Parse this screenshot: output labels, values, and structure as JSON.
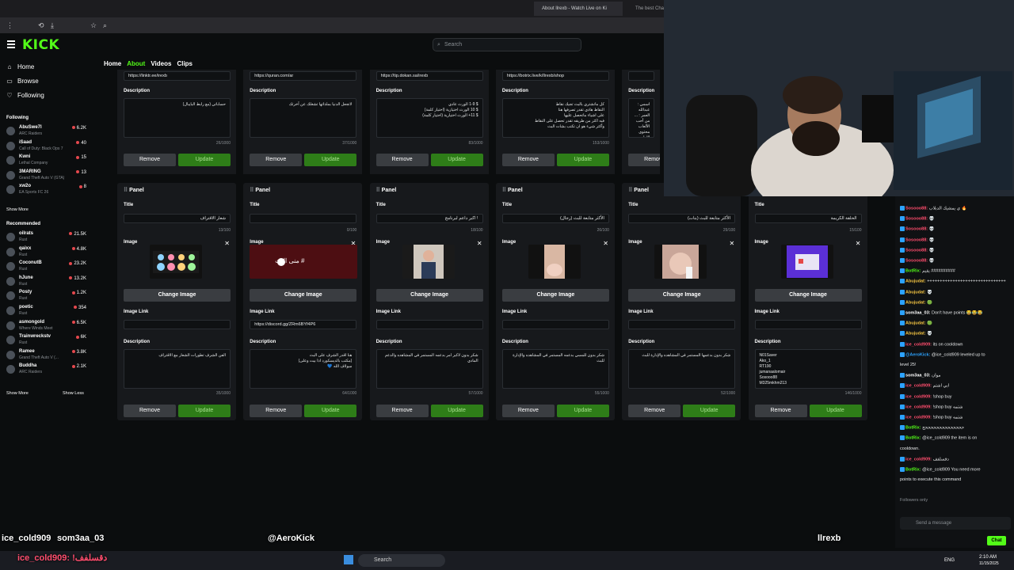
{
  "browser": {
    "tab_active": "About llrexb - Watch Live on Ki",
    "tab_other": "The best Cha"
  },
  "kick": {
    "logo": "KICK",
    "search_placeholder": "Search",
    "nav": {
      "home": "Home",
      "browse": "Browse",
      "following": "Following"
    },
    "tabs": {
      "home": "Home",
      "about": "About",
      "videos": "Videos",
      "clips": "Clips"
    }
  },
  "sidebar": {
    "following_header": "Following",
    "following": [
      {
        "name": "AbuSwe7l",
        "game": "ARC Raiders",
        "viewers": "6.2K"
      },
      {
        "name": "iSaad",
        "game": "Call of Duty: Black Ops 7",
        "viewers": "40"
      },
      {
        "name": "Kwni",
        "game": "Lethal Company",
        "viewers": "15"
      },
      {
        "name": "3MARING",
        "game": "Grand Theft Auto V (GTA)",
        "viewers": "13"
      },
      {
        "name": "xw2o",
        "game": "EA Sports FC 26",
        "viewers": "8"
      }
    ],
    "show_more_following": "Show More",
    "recommended_header": "Recommended",
    "recommended": [
      {
        "name": "oilrats",
        "game": "Rust",
        "viewers": "21.5K"
      },
      {
        "name": "qaixx",
        "game": "Rust",
        "viewers": "4.8K"
      },
      {
        "name": "CoconutB",
        "game": "Rust",
        "viewers": "23.2K"
      },
      {
        "name": "hJune",
        "game": "Rust",
        "viewers": "13.2K"
      },
      {
        "name": "Posty",
        "game": "Rust",
        "viewers": "1.2K"
      },
      {
        "name": "poetic",
        "game": "Rust",
        "viewers": "354"
      },
      {
        "name": "asmongold",
        "game": "Where Winds Meet",
        "viewers": "6.5K"
      },
      {
        "name": "Trainwreckstv",
        "game": "Rust",
        "viewers": "6K"
      },
      {
        "name": "Ramee",
        "game": "Grand Theft Auto V (...",
        "viewers": "3.8K"
      },
      {
        "name": "Buddha",
        "game": "ARC Raiders",
        "viewers": "2.1K"
      }
    ],
    "show_more": "Show More",
    "show_less": "Show Less"
  },
  "labels": {
    "panel": "Panel",
    "title": "Title",
    "image": "Image",
    "image_link": "Image Link",
    "description": "Description",
    "remove": "Remove",
    "update": "Update",
    "change_image": "Change Image"
  },
  "top_panels": [
    {
      "link": "https://linktr.ee/irexb",
      "desc": "حساباتي (مع رابط البايبال)",
      "count": "26/1000"
    },
    {
      "link": "https://quran.com/ar",
      "desc": "لاتجعل الدنيا بملذاتها تشغلك عن آخرتك",
      "count": "37/1000"
    },
    {
      "link": "https://tip.dokan.sa/irexb",
      "desc": "$ 1-9 الورث عادي\n$ 10 الورث اختيارية (اختيار كلمة)\n$ 11+ الورث اختيارية (اختيار كلمة)",
      "count": "83/1000"
    },
    {
      "link": "https://botrix.live/k/llrexb/shop",
      "desc": "كل ماتشتري بالبث تجيك نقاط\nالنقاط هاذي تقدر تصرفها هنا\nعلى اشياء ماتحصل عليها\nفيه اكثر من طريقه تقدر تحصل على النقاط\nوأكثر شيء هو ان تكتب بشات البث",
      "count": "153/1000"
    },
    {
      "link": "",
      "desc": "اسمي : عبدالله\nالعمر : ...\nمن أحب الألعاب\nمحتوى الاول\nتقدروا تتواصل على\nمن الاحترام\nلا تبدأ من",
      "count": ""
    }
  ],
  "panels": [
    {
      "title": "شعار الاقتراف",
      "title_count": "13/100",
      "link": "",
      "desc": "الفن الشرف تطورات الشعار مع الاقتراف",
      "desc_count": "35/1000"
    },
    {
      "title": "",
      "title_count": "0/100",
      "link": "https://discord.gg/ZRm6BYf4P6",
      "desc": "هنا اقدر الشرف على البث\n(مكتب بالديسكورد اذا بيت وعلى)\nسولاف الله 💙",
      "desc_count": "64/1000",
      "thumb_text": "منى البث #"
    },
    {
      "title": "! اكبر داعم لبرنامج",
      "title_count": "18/100",
      "link": "",
      "desc": "شكر بدون لاكبر امر بدعمه المستمر في المشاهده والدعم المادي",
      "desc_count": "57/1000"
    },
    {
      "title": "الأكثر متابعة للبث (رجال)",
      "title_count": "26/100",
      "link": "",
      "desc": "شكر بدون للمسي بدعمه المستمر في المشاهده والإدارة للبث",
      "desc_count": "55/1000"
    },
    {
      "title": "الأكثر متابعة للبث (بنات)",
      "title_count": "29/100",
      "link": "",
      "desc": "شكر بدون بدعمها المستمر في المشاهده والإدارة للبث",
      "desc_count": "52/1000"
    },
    {
      "title": "الحلقة الكريمة",
      "title_count": "15/100",
      "link": "",
      "desc": "N01Saver\nAko_1\nRT190\njumanaalomair\nSosooo88\nM325mkhm213",
      "desc_count": "146/1000"
    }
  ],
  "chat": {
    "lines": [
      {
        "user": "Sosooo88:",
        "text": "ي يمشيك الدبلاب 🔥",
        "color": "#ff4d6d"
      },
      {
        "user": "Sosooo88:",
        "text": "💀",
        "color": "#ff4d6d"
      },
      {
        "user": "Sosooo88:",
        "text": "💀",
        "color": "#ff4d6d"
      },
      {
        "user": "Sosooo88:",
        "text": "💀",
        "color": "#ff4d6d"
      },
      {
        "user": "Sosooo88:",
        "text": "💀",
        "color": "#ff4d6d"
      },
      {
        "user": "Sosooo88:",
        "text": "💀",
        "color": "#ff4d6d"
      },
      {
        "user": "BotRix:",
        "text": "يقيم ##########",
        "color": "#53fc18"
      },
      {
        "user": "Abujudat:",
        "text": "+++++++++++++++++++++++++++++++",
        "color": "#f5c542"
      },
      {
        "user": "Abujudat:",
        "text": "💀",
        "color": "#f5c542"
      },
      {
        "user": "Abujudat:",
        "text": "🟢",
        "color": "#f5c542"
      },
      {
        "user": "som3aa_03:",
        "text": "Don't have points 😂😂😂",
        "color": "#ffffff"
      },
      {
        "user": "Abujudat:",
        "text": "🟢",
        "color": "#f5c542"
      },
      {
        "user": "Abujudat:",
        "text": "💀",
        "color": "#f5c542"
      },
      {
        "user": "ice_cold909:",
        "text": "its on cooldown",
        "color": "#ff4d6d"
      },
      {
        "user": "@AeroKick:",
        "text": "@ice_cold909 leveled up to",
        "color": "#2da3ff"
      },
      {
        "user": "",
        "text": "level 25!",
        "color": "#ffffff"
      },
      {
        "user": "som3aa_03:",
        "text": "موان",
        "color": "#ffffff"
      },
      {
        "user": "ice_cold909:",
        "text": "ابي اشتم",
        "color": "#ff4d6d"
      },
      {
        "user": "ice_cold909:",
        "text": "!shop buy",
        "color": "#ff4d6d"
      },
      {
        "user": "ice_cold909:",
        "text": "!shop buy شتمه",
        "color": "#ff4d6d"
      },
      {
        "user": "ice_cold909:",
        "text": "!shop buy شتمه",
        "color": "#ff4d6d"
      },
      {
        "user": "BotRix:",
        "text": "ححححححححححححححح",
        "color": "#53fc18"
      },
      {
        "user": "BotRix:",
        "text": "@ice_cold909 the item is on",
        "color": "#53fc18"
      },
      {
        "user": "",
        "text": "cooldown.",
        "color": "#ffffff"
      },
      {
        "user": "ice_cold909:",
        "text": "دقسلفف",
        "color": "#ff4d6d"
      },
      {
        "user": "BotRix:",
        "text": "@ice_cold909 You need more",
        "color": "#53fc18"
      },
      {
        "user": "",
        "text": "points to execute this command",
        "color": "#ffffff"
      }
    ],
    "followers_only": "Followers only",
    "send_placeholder": "Send a message",
    "chat_button": "Chat"
  },
  "overlay": {
    "user_left": "ice_cold909",
    "user_left2": "som3aa_03",
    "user_mid": "@AeroKick",
    "user_right": "llrexb",
    "bottom_msg": "ice_cold909: !دقسلفف"
  },
  "taskbar": {
    "search": "Search",
    "lang": "ENG",
    "time": "2:10 AM",
    "date": "11/15/2025"
  }
}
